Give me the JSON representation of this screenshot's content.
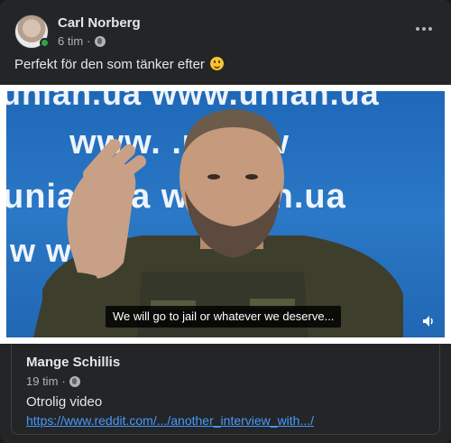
{
  "post": {
    "author": "Carl Norberg",
    "time": "6 tim",
    "separator": "·",
    "privacy_icon": "globe-icon",
    "text": "Perfekt för den som tänker efter",
    "emoji": "smiling-face-emoji"
  },
  "video": {
    "background_text": {
      "row1": "unian.ua          www.unian.ua",
      "row2": "www.        .ua          ww",
      "row3": "unian.ua        w.unian.ua",
      "row4": "w                                   w"
    },
    "subtitle": "We will go to jail or whatever we deserve...",
    "volume_icon": "speaker-icon"
  },
  "shared": {
    "author": "Mange Schillis",
    "time": "19 tim",
    "separator": "·",
    "text": "Otrolig video",
    "link": "https://www.reddit.com/.../another_interview_with.../"
  },
  "colors": {
    "background": "#242526",
    "link": "#4599ff",
    "online": "#31a24c",
    "video_backdrop": "#2a78c6"
  }
}
